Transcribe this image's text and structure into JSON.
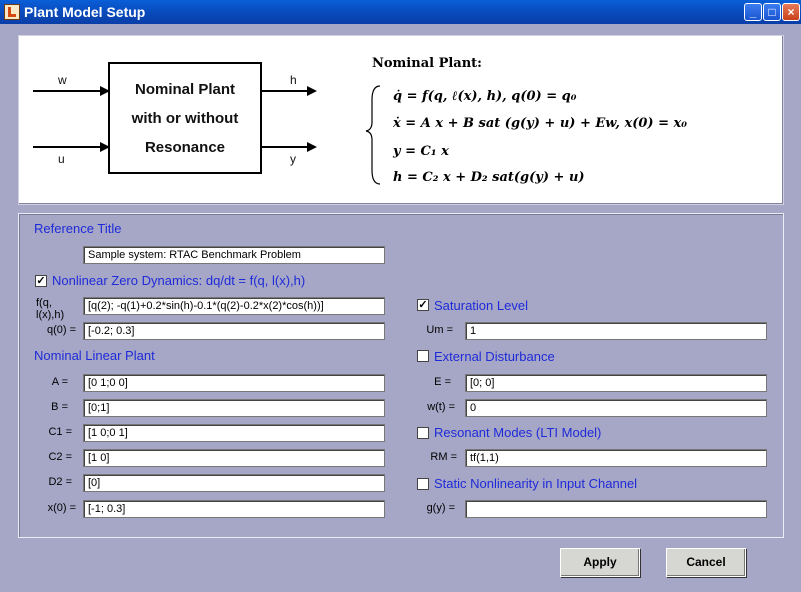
{
  "window": {
    "title": "Plant Model Setup",
    "icon": "matlab-icon"
  },
  "titlebar_buttons": {
    "minimize": "_",
    "maximize": "□",
    "close": "×"
  },
  "diagram": {
    "block_lines": [
      "Nominal Plant",
      "with or without",
      "Resonance"
    ],
    "inputs": [
      "w",
      "u"
    ],
    "outputs": [
      "h",
      "y"
    ]
  },
  "equations": {
    "title": "Nominal Plant:",
    "lines": [
      "q̇ = f(q, ℓ(x), h),    q(0) = q₀",
      "ẋ = A x + B sat (g(y) + u) + Ew,   x(0) = x₀",
      "y = C₁ x",
      "h = C₂ x + D₂ sat(g(y) + u)"
    ]
  },
  "form": {
    "reference_title_label": "Reference Title",
    "reference_title_value": "Sample system: RTAC Benchmark Problem",
    "nonlinear_zero_dynamics": {
      "label": "Nonlinear Zero Dynamics: dq/dt = f(q, l(x),h)",
      "checked": true
    },
    "f_label": "f(q, l(x),h)",
    "f_value": "[q(2); -q(1)+0.2*sin(h)-0.1*(q(2)-0.2*x(2)*cos(h))]",
    "q0_label": "q(0) =",
    "q0_value": "[-0.2; 0.3]",
    "nominal_linear_plant_label": "Nominal Linear Plant",
    "A_label": "A =",
    "A_value": "[0 1;0 0]",
    "B_label": "B =",
    "B_value": "[0;1]",
    "C1_label": "C1 =",
    "C1_value": "[1 0;0 1]",
    "C2_label": "C2 =",
    "C2_value": "[1 0]",
    "D2_label": "D2 =",
    "D2_value": "[0]",
    "x0_label": "x(0) =",
    "x0_value": "[-1; 0.3]",
    "saturation": {
      "label": "Saturation Level",
      "checked": true
    },
    "Um_label": "Um =",
    "Um_value": "1",
    "external_disturbance": {
      "label": "External Disturbance",
      "checked": false
    },
    "E_label": "E =",
    "E_value": "[0; 0]",
    "wt_label": "w(t) =",
    "wt_value": "0",
    "resonant_modes": {
      "label": "Resonant Modes (LTI Model)",
      "checked": false
    },
    "RM_label": "RM =",
    "RM_value": "tf(1,1)",
    "static_nonlinearity": {
      "label": "Static Nonlinearity in Input Channel",
      "checked": false
    },
    "gy_label": "g(y) =",
    "gy_value": ""
  },
  "buttons": {
    "apply": "Apply",
    "cancel": "Cancel"
  },
  "colors": {
    "accent": "#1f2bd8",
    "background": "#a6a6c6",
    "titlebar": "#0848b8"
  }
}
